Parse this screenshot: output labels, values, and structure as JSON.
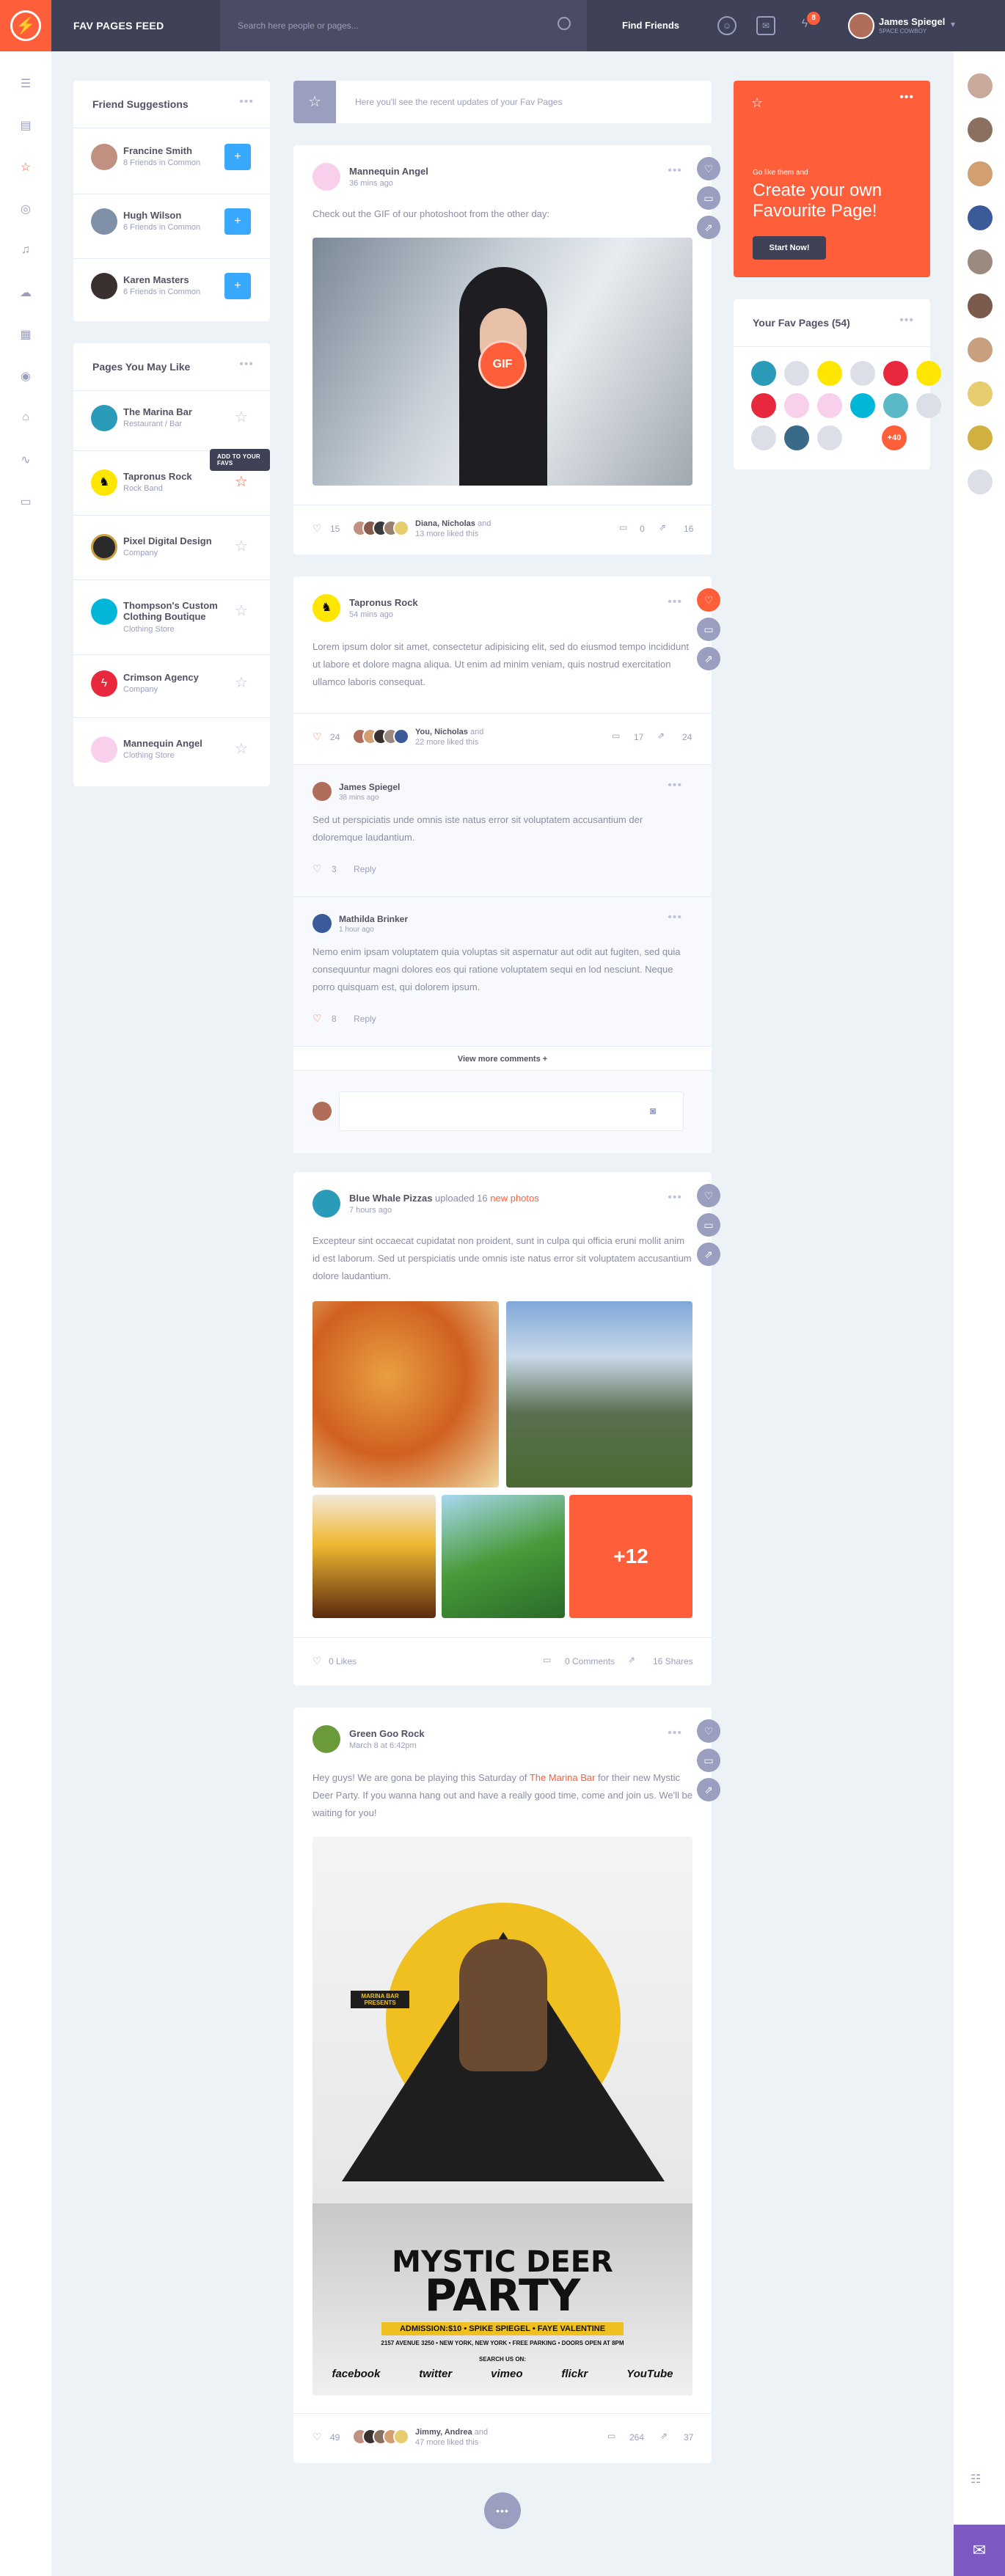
{
  "header": {
    "title": "FAV PAGES FEED",
    "search_placeholder": "Search here people or pages...",
    "find_friends": "Find Friends",
    "notification_count": "8",
    "user": {
      "name": "James Spiegel",
      "status": "SPACE COWBOY"
    }
  },
  "friend_suggestions": {
    "title": "Friend Suggestions",
    "items": [
      {
        "name": "Francine Smith",
        "sub": "8 Friends in Common"
      },
      {
        "name": "Hugh Wilson",
        "sub": "6 Friends in Common"
      },
      {
        "name": "Karen Masters",
        "sub": "6 Friends in Common"
      }
    ]
  },
  "pages_you_may_like": {
    "title": "Pages You May Like",
    "tooltip": "ADD TO YOUR FAVS",
    "items": [
      {
        "name": "The Marina Bar",
        "sub": "Restaurant / Bar"
      },
      {
        "name": "Tapronus Rock",
        "sub": "Rock Band"
      },
      {
        "name": "Pixel Digital Design",
        "sub": "Company"
      },
      {
        "name": "Thompson's Custom Clothing Boutique",
        "sub": "Clothing Store"
      },
      {
        "name": "Crimson Agency",
        "sub": "Company"
      },
      {
        "name": "Mannequin Angel",
        "sub": "Clothing Store"
      }
    ]
  },
  "banner": {
    "text": "Here you'll see the recent updates of your Fav Pages"
  },
  "promo": {
    "small": "Go like them and",
    "title": "Create your own Favourite Page!",
    "button": "Start Now!"
  },
  "fav_pages": {
    "title": "Your Fav Pages (54)",
    "more": "+40"
  },
  "posts": [
    {
      "author": "Mannequin Angel",
      "time": "36 mins ago",
      "text": "Check out the GIF of our photoshoot from the other day:",
      "gif_label": "GIF",
      "likes": "15",
      "liked_names": "Diana, Nicholas",
      "liked_and": "and",
      "liked_more": "13 more liked this",
      "comments": "0",
      "shares": "16"
    },
    {
      "author": "Tapronus Rock",
      "time": "54 mins ago",
      "text": "Lorem ipsum dolor sit amet, consectetur adipisicing elit, sed do eiusmod tempo incididunt ut labore et dolore magna aliqua. Ut enim ad minim veniam, quis nostrud exercitation ullamco laboris consequat.",
      "likes": "24",
      "liked_names": "You, Nicholas",
      "liked_and": "and",
      "liked_more": "22 more liked this",
      "comments": "17",
      "shares": "24"
    },
    {
      "author": "Blue Whale Pizzas",
      "action": "uploaded 16",
      "action_link": "new photos",
      "time": "7 hours ago",
      "text": "Excepteur sint occaecat cupidatat non proident, sunt in culpa qui officia eruni mollit anim id est laborum. Sed ut perspiciatis unde omnis iste natus error sit voluptatem accusantium dolore laudantium.",
      "more_photos": "+12",
      "likes": "0 Likes",
      "comments": "0 Comments",
      "shares": "16 Shares"
    },
    {
      "author": "Green Goo Rock",
      "time": "March 8 at 6:42pm",
      "text_a": "Hey guys! We are gona be playing this Saturday of",
      "text_link": "The Marina Bar",
      "text_b": "for their new Mystic Deer Party. If you wanna hang out and have a really good time, come and join us. We'll be waiting for you!",
      "poster": {
        "presents": "MARINA BAR PRESENTS",
        "title1": "MYSTIC DEER",
        "title2": "PARTY",
        "admission": "ADMISSION:$10 • SPIKE SPIEGEL • FAYE VALENTINE",
        "address": "2157 AVENUE 3250 • NEW YORK, NEW YORK • FREE PARKING • DOORS OPEN AT 8PM",
        "search": "SEARCH US ON:",
        "socials": [
          "facebook",
          "twitter",
          "vimeo",
          "flickr",
          "YouTube"
        ]
      },
      "likes": "49",
      "liked_names": "Jimmy, Andrea",
      "liked_and": "and",
      "liked_more": "47 more liked this",
      "comments": "264",
      "shares": "37"
    }
  ],
  "comments": [
    {
      "author": "James Spiegel",
      "time": "38 mins ago",
      "text": "Sed ut perspiciatis unde omnis iste natus error sit voluptatem accusantium der doloremque laudantium.",
      "likes": "3",
      "reply": "Reply"
    },
    {
      "author": "Mathilda Brinker",
      "time": "1 hour ago",
      "text": "Nemo enim ipsam voluptatem quia voluptas sit aspernatur aut odit aut fugiten, sed quia consequuntur magni dolores eos qui ratione voluptatem sequi en lod nesciunt. Neque porro quisquam est, qui dolorem ipsum.",
      "likes": "8",
      "reply": "Reply"
    }
  ],
  "view_more": "View more comments +",
  "colors": {
    "accent": "#ff5e3a",
    "dark": "#3f4257",
    "blue": "#38a9ff",
    "purple": "#7c5ac2"
  }
}
